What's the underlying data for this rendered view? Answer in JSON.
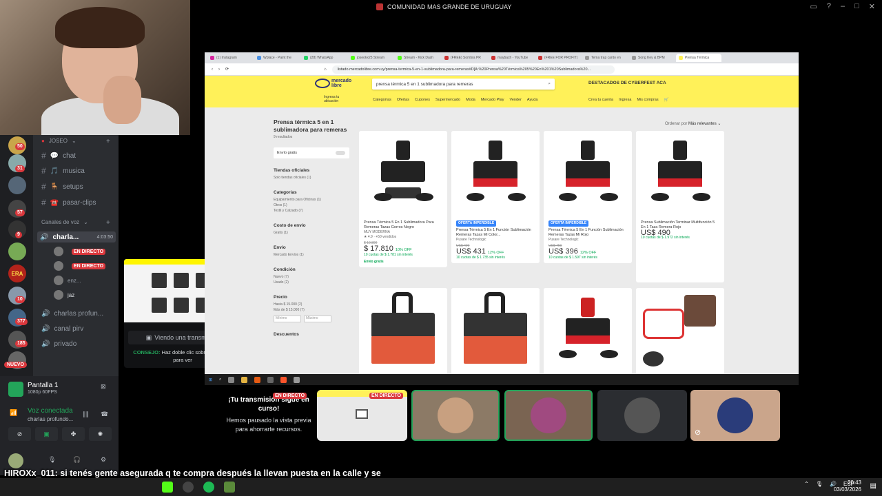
{
  "top_bar": {
    "title": "COMUNIDAD MAS GRANDE DE URUGUAY"
  },
  "servers": {
    "badges": [
      "50",
      "31",
      "57",
      "9",
      "10",
      "377",
      "185"
    ],
    "era_label": "ERA",
    "new_badge": "NUEVO"
  },
  "channels": {
    "category": "JOSEO",
    "text": [
      {
        "icon": "💬",
        "name": "chat"
      },
      {
        "icon": "🎵",
        "name": "musica"
      },
      {
        "icon": "🪑",
        "name": "setups"
      },
      {
        "icon": "☎️",
        "name": "pasar-clips"
      }
    ],
    "voice_header": "Canales de voz",
    "voice_active": {
      "name": "charla...",
      "timer": "4:03:50"
    },
    "voice_users": [
      {
        "name": "",
        "live": "EN DIRECTO"
      },
      {
        "name": "",
        "live": "EN DIRECTO"
      },
      {
        "name": "enz...",
        "live": ""
      },
      {
        "name": "jaz",
        "live": ""
      }
    ],
    "voice_others": [
      "charlas profun...",
      "canal pirv",
      "privado"
    ]
  },
  "preview": {
    "watching": "Viendo una transmisión",
    "tip_label": "CONSEJO:",
    "tip_text": "Haz doble clic sobre el usuario para ver"
  },
  "user_panel": {
    "screen_title": "Pantalla 1",
    "screen_sub": "1080p 60FPS",
    "voice_status": "Voz conectada",
    "voice_channel": "charlas profundo..."
  },
  "browser": {
    "tabs": [
      "(1) Instagram",
      "Wplace - Paint the",
      "(28) WhatsApp",
      "joseokx25 Stream",
      "Stream - Kick Dash",
      "(FREE) Sombra PR",
      "maybach - YouTube",
      "(FREE FOR PROFIT)",
      "Tema trap canto en",
      "Song Key & BPM",
      "Prensa Térmica"
    ],
    "url": "listado.mercadolibre.com.uy/prensa-termica-5-en-1-sublimadora-para-remeras#D[A:%20Prensa%20Térmica%205%20En%201%20Sublimadora%20..."
  },
  "ml": {
    "logo_line1": "mercado",
    "logo_line2": "libre",
    "search_value": "prensa térmica 5 en 1 sublimadora para remeras",
    "promo": "DESTACADOS DE CYBERFEST",
    "promo_aca": "ACA",
    "location_l1": "Ingresa tu",
    "location_l2": "ubicación",
    "nav": [
      "Categorías",
      "Ofertas",
      "Cupones",
      "Supermercado",
      "Moda",
      "Mercado Play",
      "Vender",
      "Ayuda"
    ],
    "right_nav": [
      "Crea tu cuenta",
      "Ingresa",
      "Mis compras"
    ],
    "results_title": "Prensa térmica 5 en 1 sublimadora para remeras",
    "results_count": "9 resultados",
    "sort_label": "Ordenar por",
    "sort_value": "Más relevantes",
    "envio_gratis": "Envío gratis",
    "filters": [
      {
        "title": "Tiendas oficiales",
        "options": "Solo tiendas oficiales (1)"
      },
      {
        "title": "Categorías",
        "options": "Equipamiento para Oficinas (1)\nOtros (1)\nTextil y Calzado (7)"
      },
      {
        "title": "Costo de envío",
        "options": "Gratis (1)"
      },
      {
        "title": "Envío",
        "options": "Mercado Envíos (1)"
      },
      {
        "title": "Condición",
        "options": "Nuevo (7)\nUsado (2)"
      },
      {
        "title": "Precio",
        "options": "Hasta $ 15.000 (2)\nMás de $ 15.000 (7)"
      }
    ],
    "price_min": "Mínimo",
    "price_max": "Máximo",
    "descuentos": "Descuentos",
    "products": [
      {
        "badge": "",
        "title": "Prensa Térmica 5 En 1 Sublimadora Para Remeras Tazas Gorros Negro",
        "brand": "MUY MODERNA",
        "rating": "★ 4.9 · +50 vendidos",
        "old": "$ 19.890",
        "price": "$ 17.810",
        "off": "10% OFF",
        "inst": "10 cuotas de $ 1.781 sin interés",
        "free": "Envío gratis"
      },
      {
        "badge": "OFERTA IMPERDIBLE",
        "title": "Prensa Térmica 5 En 1 Función Sublimación Remeras Tazas Mi Color...",
        "brand": "Pusare Technologic",
        "rating": "",
        "old": "US$ 490",
        "price": "US$ 431",
        "off": "12% OFF",
        "inst": "10 cuotas de $ 1.735 sin interés",
        "free": ""
      },
      {
        "badge": "OFERTA IMPERDIBLE",
        "title": "Prensa Térmica 5 En 1 Función Sublimación Remeras Tazas Mi Rojo",
        "brand": "Pusare Technologic",
        "rating": "",
        "old": "US$ 450",
        "price": "US$ 396",
        "off": "12% OFF",
        "inst": "10 cuotas de $ 1.597 sin interés",
        "free": ""
      },
      {
        "badge": "",
        "title": "Prensa Sublimación Terminar Multifunción 5 En 1 Taza Remera Rojo",
        "brand": "",
        "rating": "",
        "old": "",
        "price": "US$ 490",
        "off": "",
        "inst": "10 cuotas de $ 1.972 sin interés",
        "free": ""
      }
    ]
  },
  "stream_tiles": {
    "paused_title": "¡Tu transmisión sigue en curso!",
    "paused_sub": "Hemos pausado la vista previa para ahorrarte recursos.",
    "live": "EN DIRECTO"
  },
  "chat": {
    "user": "HIROXx_011",
    "message": ": si tenés gente asegurada q te compra después la llevan puesta en la calle y se va a ser conocida tu marca"
  },
  "taskbar": {
    "lang": "ESP",
    "time": "20:43",
    "date": "03/03/2026"
  }
}
